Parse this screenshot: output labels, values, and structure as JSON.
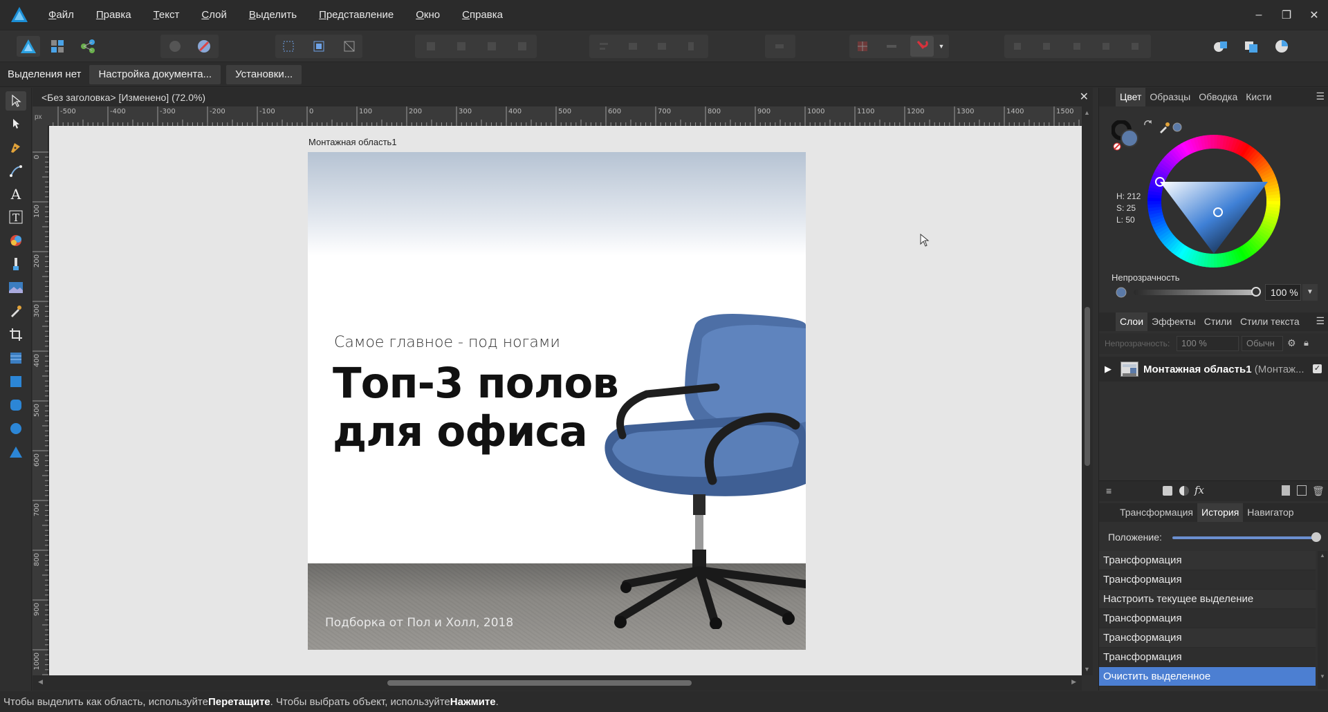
{
  "menu": [
    "Файл",
    "Правка",
    "Текст",
    "Слой",
    "Выделить",
    "Представление",
    "Окно",
    "Справка"
  ],
  "window_controls": {
    "minimize": "–",
    "restore": "❐",
    "close": "✕"
  },
  "context_bar": {
    "no_selection": "Выделения нет",
    "doc_setup": "Настройка документа...",
    "preferences": "Установки..."
  },
  "document": {
    "tab_title": "<Без заголовка> [Изменено] (72.0%)",
    "close": "✕"
  },
  "rulers": {
    "unit": "px",
    "horizontal": [
      "-500",
      "-400",
      "-300",
      "-200",
      "-100",
      "0",
      "100",
      "200",
      "300",
      "400",
      "500",
      "600",
      "700",
      "800",
      "900",
      "1000",
      "1100",
      "1200",
      "1300",
      "1400",
      "1500"
    ],
    "vertical": [
      "0",
      "100",
      "200",
      "300",
      "400",
      "500",
      "600",
      "700",
      "800",
      "900",
      "1000"
    ]
  },
  "artboard": {
    "label": "Монтажная область1",
    "subtitle": "Самое главное - под ногами",
    "headline_line1": "Топ-3 полов",
    "headline_line2": "для офиса",
    "footnote": "Подборка от Пол и Холл, 2018"
  },
  "color_panel": {
    "tabs": [
      "Цвет",
      "Образцы",
      "Обводка",
      "Кисти"
    ],
    "active_tab": "Цвет",
    "h": "H: 212",
    "s": "S: 25",
    "l": "L: 50",
    "opacity_label": "Непрозрачность",
    "opacity_value": "100 %",
    "current_color": "#5b7aa8"
  },
  "layers_panel": {
    "tabs": [
      "Слои",
      "Эффекты",
      "Стили",
      "Стили текста"
    ],
    "active_tab": "Слои",
    "opacity_label": "Непрозрачность:",
    "opacity_value": "100 %",
    "blend_mode": "Обычн",
    "layer_name": "Монтажная область1",
    "layer_type": "(Монтаж..."
  },
  "history_panel": {
    "tabs": [
      "Трансформация",
      "История",
      "Навигатор"
    ],
    "active_tab": "История",
    "position_label": "Положение:",
    "items": [
      "Трансформация",
      "Трансформация",
      "Настроить текущее выделение",
      "Трансформация",
      "Трансформация",
      "Трансформация",
      "Очистить выделенное"
    ]
  },
  "status": {
    "part1": "Чтобы выделить как область, используйте ",
    "bold1": "Перетащите",
    "part2": ". Чтобы выбрать объект, используйте ",
    "bold2": "Нажмите",
    "part3": "."
  },
  "colors": {
    "accent": "#4c7fd2",
    "chair": "#4d6fa6",
    "snap_red": "#d8323c"
  }
}
